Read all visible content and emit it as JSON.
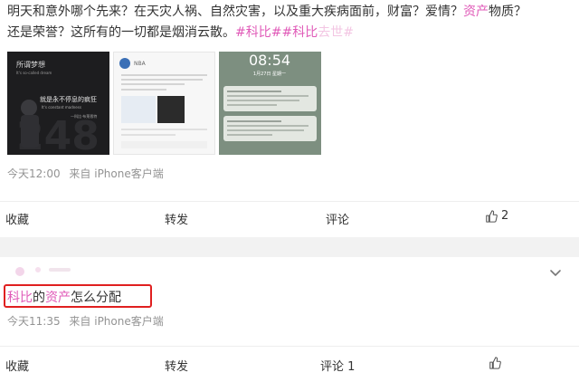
{
  "post": {
    "line1": "明天和意外哪个先来？在天灾人祸、自然灾害，以及重大疾病面前，财富？爱情？",
    "line1_hl": "资产",
    "line1_end": "物质？",
    "line2": "还是荣誉？这所有的一切都是烟消云散。",
    "tags": [
      "#科比#",
      "#科比",
      "去世#"
    ],
    "images": [
      {
        "title": "所谓梦想",
        "subtitle": "It's so-called dream",
        "quote": "就是永不停息的疯狂",
        "quote_en": "It's constant madness",
        "author": "—科比·布莱恩特",
        "big": "248"
      },
      {
        "header": "NBA",
        "body": "NBA官方发布声明"
      },
      {
        "time": "08:54",
        "date": "1月27日 星期一",
        "note1": "...",
        "note2": "..."
      }
    ],
    "timestamp": "今天12:00",
    "source": "来自 iPhone客户端",
    "actions": {
      "collect": "收藏",
      "repost": "转发",
      "comment": "评论",
      "like_count": "2"
    }
  },
  "comment": {
    "text_hl1": "科比",
    "text_mid": "的",
    "text_hl2": "资产",
    "text_end": "怎么分配",
    "timestamp": "今天11:35",
    "source": "来自 iPhone客户端",
    "actions": {
      "collect": "收藏",
      "repost": "转发",
      "comment": "评论 1"
    }
  },
  "colors": {
    "highlight": "#e05ab8",
    "link": "#eb7350",
    "box": "#e02020"
  }
}
